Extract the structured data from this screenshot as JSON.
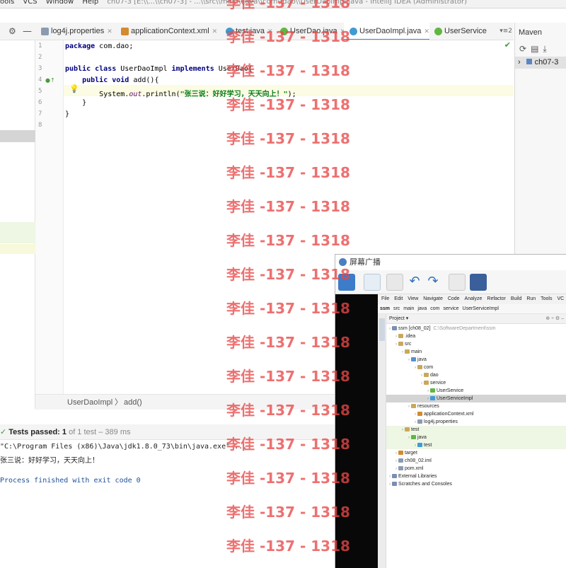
{
  "titlebar": {
    "menus": [
      "ools",
      "VCS",
      "Window",
      "Help"
    ],
    "title": "ch07-3 [E:\\\\...\\\\ch07-3] - ...\\\\src\\\\main\\\\java\\\\com\\\\dao\\\\UserDaoImpl.java - IntelliJ IDEA (Administrator)"
  },
  "tabs": [
    {
      "label": "log4j.properties",
      "color": "#8a9bb0",
      "active": false
    },
    {
      "label": "applicationContext.xml",
      "color": "#d48a2e",
      "active": false
    },
    {
      "label": "test.java",
      "color": "#3f9bd6",
      "active": false
    },
    {
      "label": "UserDao.java",
      "color": "#62b543",
      "active": false
    },
    {
      "label": "UserDaoImpl.java",
      "color": "#3f9bd6",
      "active": true
    },
    {
      "label": "UserService",
      "color": "#62b543",
      "active": false
    }
  ],
  "tab_more": "▾≡2",
  "maven": {
    "title": "Maven",
    "project": "ch07-3"
  },
  "editor": {
    "line_numbers": [
      "1",
      "2",
      "3",
      "4",
      "5",
      "6",
      "7",
      "8"
    ],
    "l1_kw": "package",
    "l1_rest": " com.dao;",
    "l3_kw": "public class",
    "l3_mid": " UserDaoImpl ",
    "l3_kw2": "implements",
    "l3_rest": " UserDao{",
    "l4_kw": "public void",
    "l4_rest": " add(){",
    "l5_a": "System.",
    "l5_out": "out",
    "l5_b": ".println(",
    "l5_str": "\"张三说：好好学习，天天向上！\"",
    "l5_c": ");",
    "l6": "}",
    "l7": "}"
  },
  "breadcrumb": {
    "class": "UserDaoImpl",
    "method": "add()"
  },
  "run": {
    "status_bold": "Tests passed: 1",
    "status_rest": " of 1 test – 389 ms",
    "cmd": "\"C:\\Program Files (x86)\\Java\\jdk1.8.0_73\\bin\\java.exe\" ...",
    "output": "张三说：好好学习，天天向上！",
    "exit": "Process finished with exit code 0"
  },
  "broadcast": {
    "title": "屏幕广播",
    "menu": [
      "File",
      "Edit",
      "View",
      "Navigate",
      "Code",
      "Analyze",
      "Refactor",
      "Build",
      "Run",
      "Tools",
      "VC"
    ],
    "crumbs": [
      "ssm",
      "src",
      "main",
      "java",
      "com",
      "service",
      "UserServiceImpl"
    ],
    "panel_title": "Project",
    "tree": [
      {
        "label": "ssm [ch08_02]",
        "extra": "C:\\SoftwareDepartment\\ssm",
        "indent": 0,
        "color": "#7a8fb0"
      },
      {
        "label": ".idea",
        "extra": "",
        "indent": 1,
        "color": "#c9a85a"
      },
      {
        "label": "src",
        "extra": "",
        "indent": 1,
        "color": "#c9a85a"
      },
      {
        "label": "main",
        "extra": "",
        "indent": 2,
        "color": "#c9a85a"
      },
      {
        "label": "java",
        "extra": "",
        "indent": 3,
        "color": "#5a8fd0"
      },
      {
        "label": "com",
        "extra": "",
        "indent": 4,
        "color": "#c9a85a"
      },
      {
        "label": "dao",
        "extra": "",
        "indent": 5,
        "color": "#c9a85a"
      },
      {
        "label": "service",
        "extra": "",
        "indent": 5,
        "color": "#c9a85a"
      },
      {
        "label": "UserService",
        "extra": "",
        "indent": 6,
        "color": "#62b543"
      },
      {
        "label": "UserServiceImpl",
        "extra": "",
        "indent": 6,
        "color": "#3f9bd6"
      },
      {
        "label": "resources",
        "extra": "",
        "indent": 3,
        "color": "#c9a85a"
      },
      {
        "label": "applicationContext.xml",
        "extra": "",
        "indent": 4,
        "color": "#d48a2e"
      },
      {
        "label": "log4j.properties",
        "extra": "",
        "indent": 4,
        "color": "#8a9bb0"
      },
      {
        "label": "test",
        "extra": "",
        "indent": 2,
        "color": "#c9a85a"
      },
      {
        "label": "java",
        "extra": "",
        "indent": 3,
        "color": "#62b543"
      },
      {
        "label": "test",
        "extra": "",
        "indent": 4,
        "color": "#3f9bd6"
      },
      {
        "label": "target",
        "extra": "",
        "indent": 1,
        "color": "#d48a2e"
      },
      {
        "label": "ch08_02.iml",
        "extra": "",
        "indent": 1,
        "color": "#8a9bb0"
      },
      {
        "label": "pom.xml",
        "extra": "",
        "indent": 1,
        "color": "#8a9bb0"
      },
      {
        "label": "External Libraries",
        "extra": "",
        "indent": 0,
        "color": "#7a8fb0"
      },
      {
        "label": "Scratches and Consoles",
        "extra": "",
        "indent": 0,
        "color": "#7a8fb0"
      }
    ]
  },
  "watermark": "李佳 -137 - 1318",
  "colors": {
    "accent": "#4a88c7",
    "watermark": "#e84848"
  }
}
